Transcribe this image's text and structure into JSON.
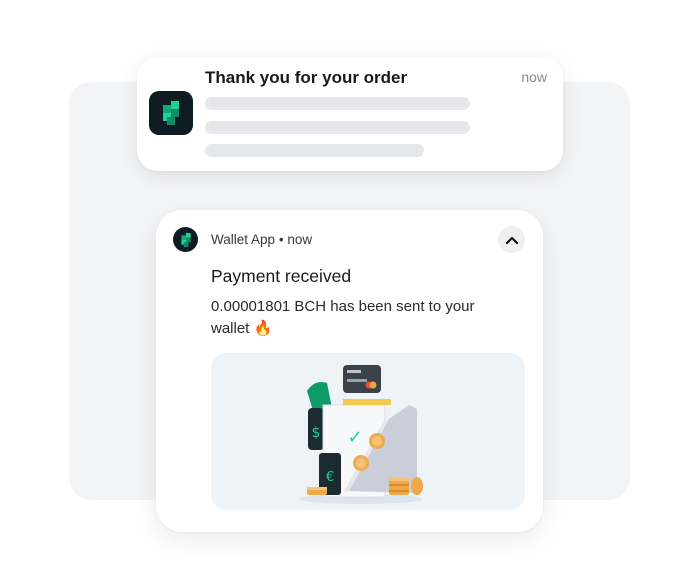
{
  "notification_order": {
    "title": "Thank you for your order",
    "time": "now"
  },
  "notification_payment": {
    "app_name": "Wallet App",
    "separator": "•",
    "time": "now",
    "title": "Payment received",
    "body_line1": "0.00001801 BCH has been sent to your",
    "body_line2": "wallet",
    "emoji": "🔥",
    "illustration": {
      "dollar_symbol": "$",
      "euro_symbol": "€",
      "check_symbol": "✓"
    }
  },
  "colors": {
    "app_icon_bg": "#0d1b22",
    "brand_green": "#1fd193",
    "coin": "#f0a94a"
  },
  "icons": {
    "app_logo": "wallet-app-logo-icon",
    "collapse": "chevron-up-icon"
  }
}
